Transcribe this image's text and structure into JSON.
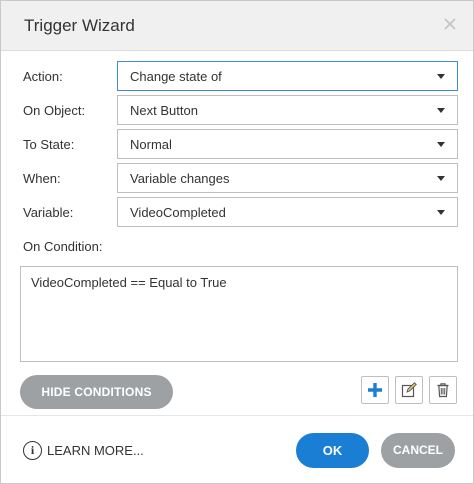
{
  "dialog": {
    "title": "Trigger Wizard",
    "close_icon": "close-x-icon"
  },
  "fields": {
    "action": {
      "label": "Action:",
      "value": "Change state of"
    },
    "on_object": {
      "label": "On Object:",
      "value": "Next Button"
    },
    "to_state": {
      "label": "To State:",
      "value": "Normal"
    },
    "when": {
      "label": "When:",
      "value": "Variable changes"
    },
    "variable": {
      "label": "Variable:",
      "value": "VideoCompleted"
    }
  },
  "condition": {
    "label": "On Condition:",
    "text": "VideoCompleted == Equal to True"
  },
  "buttons": {
    "hide_conditions": "HIDE CONDITIONS",
    "ok": "OK",
    "cancel": "CANCEL",
    "learn_more": "LEARN MORE...",
    "info_glyph": "i"
  },
  "icons": {
    "add": "plus-icon",
    "edit": "edit-icon",
    "delete": "trash-icon"
  },
  "colors": {
    "accent": "#1a7fd4",
    "active_border": "#3b8be0",
    "muted_button": "#9ea1a4",
    "add_icon": "#1a7fd4"
  }
}
